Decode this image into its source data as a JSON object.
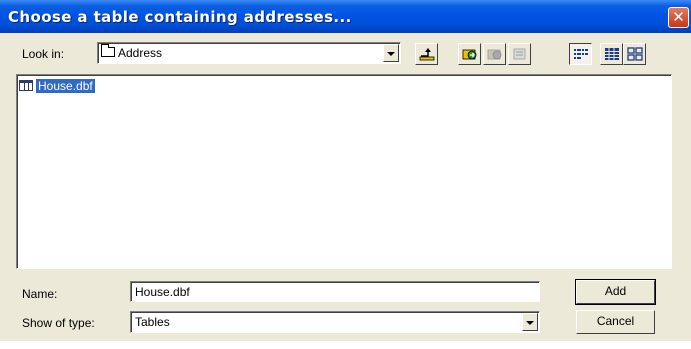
{
  "dialog": {
    "title": "Choose a table containing addresses...",
    "close_glyph": "✕"
  },
  "look_in": {
    "label": "Look in:",
    "value": "Address"
  },
  "toolbar": {
    "icons": [
      "up-one-level-icon",
      "connect-folder-icon",
      "disconnect-folder-icon",
      "delete-icon",
      "list-view-icon",
      "details-view-icon",
      "thumbnails-view-icon"
    ]
  },
  "files": [
    {
      "name": "House.dbf",
      "icon": "table-icon",
      "selected": true
    }
  ],
  "name_field": {
    "label": "Name:",
    "value": "House.dbf"
  },
  "type_field": {
    "label": "Show of type:",
    "value": "Tables"
  },
  "buttons": {
    "add": "Add",
    "cancel": "Cancel"
  },
  "colors": {
    "titlebar": "#0054e3",
    "dialog_bg": "#ece9d8",
    "selection": "#316ac5",
    "close_button": "#c2391a"
  }
}
